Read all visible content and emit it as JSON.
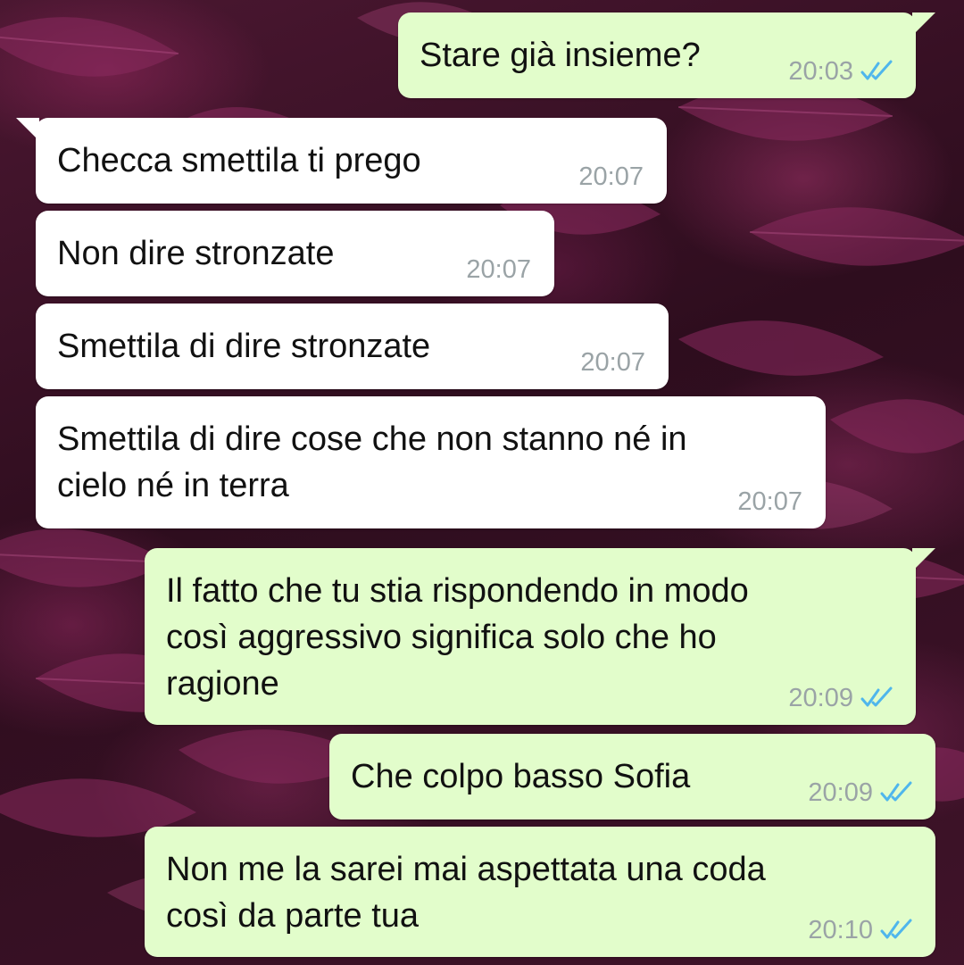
{
  "chat": {
    "messages": [
      {
        "direction": "out",
        "text": "Stare già insieme?",
        "time": "20:03",
        "status_icon": "double-check-icon"
      },
      {
        "direction": "in",
        "text": "Checca smettila ti prego",
        "time": "20:07"
      },
      {
        "direction": "in",
        "text": "Non dire stronzate",
        "time": "20:07"
      },
      {
        "direction": "in",
        "text": "Smettila di dire stronzate",
        "time": "20:07"
      },
      {
        "direction": "in",
        "text": "Smettila di dire cose che non stanno né in\ncielo né in terra",
        "time": "20:07"
      },
      {
        "direction": "out",
        "text": "Il fatto che tu stia rispondendo in modo\ncosì aggressivo significa solo che ho\nragione",
        "time": "20:09",
        "status_icon": "double-check-icon"
      },
      {
        "direction": "out",
        "text": "Che colpo basso Sofia",
        "time": "20:09",
        "status_icon": "double-check-icon"
      },
      {
        "direction": "out",
        "text": "Non me la sarei mai aspettata una coda\ncosì da parte tua",
        "time": "20:10",
        "status_icon": "double-check-icon"
      }
    ]
  },
  "colors": {
    "outgoing_bubble": "#e2fdcb",
    "incoming_bubble": "#ffffff",
    "timestamp": "#9aa3a6",
    "read_ticks": "#4fb6ec"
  }
}
